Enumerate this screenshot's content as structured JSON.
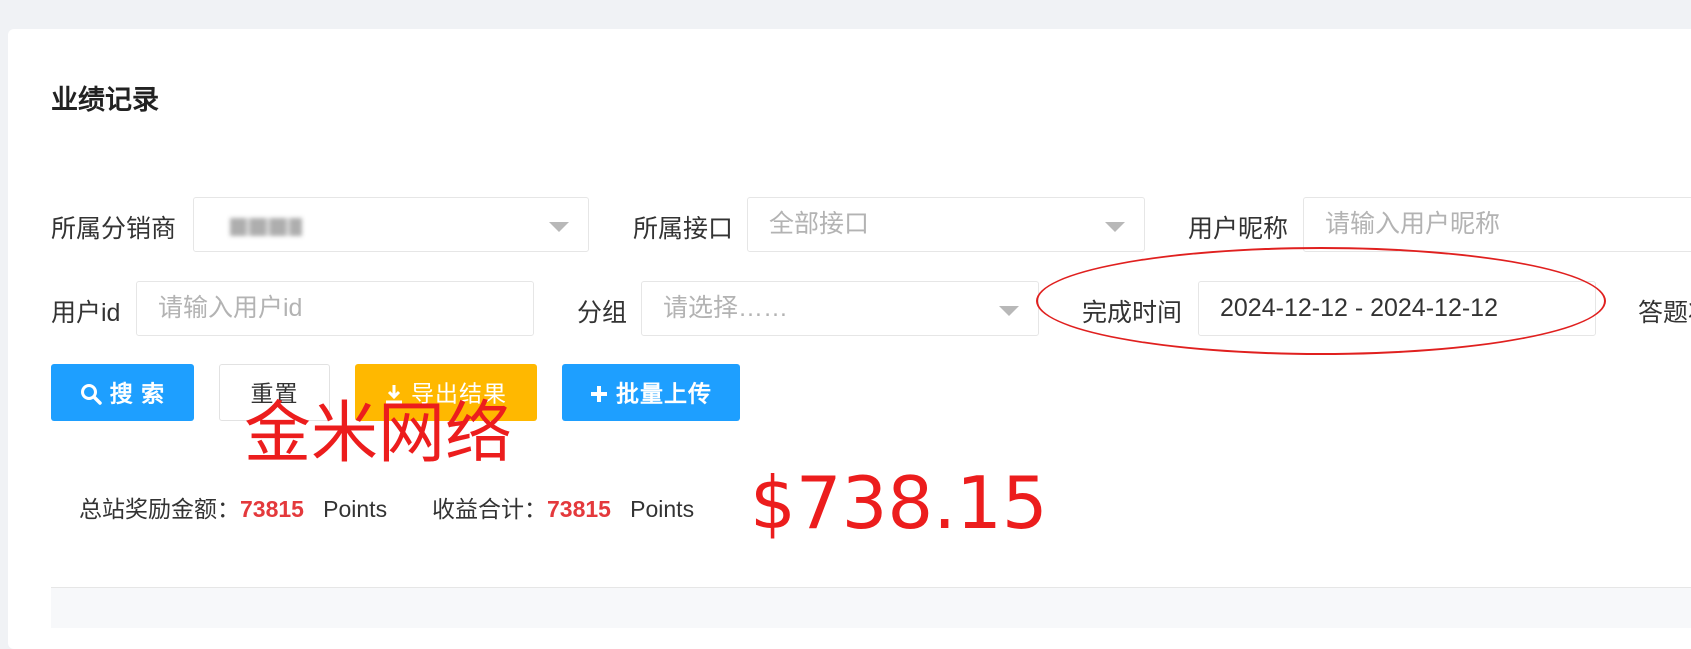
{
  "page": {
    "title": "业绩记录"
  },
  "filters": {
    "distributor": {
      "label": "所属分销商",
      "value": ""
    },
    "interface": {
      "label": "所属接口",
      "value": "全部接口"
    },
    "nickname": {
      "label": "用户昵称",
      "placeholder": "请输入用户昵称"
    },
    "user_id": {
      "label": "用户id",
      "placeholder": "请输入用户id"
    },
    "group": {
      "label": "分组",
      "placeholder": "请选择……"
    },
    "finish_time": {
      "label": "完成时间",
      "value": "2024-12-12 - 2024-12-12"
    },
    "truncated_label": "答题状"
  },
  "actions": {
    "search": "搜 索",
    "reset": "重置",
    "export": "导出结果",
    "batch_upload": "批量上传"
  },
  "summary": {
    "reward_label": "总站奖励金额：",
    "reward_value": "73815",
    "reward_unit": "Points",
    "income_label": "收益合计：",
    "income_value": "73815",
    "income_unit": "Points"
  },
  "overlays": {
    "watermark": "金米网络",
    "amount": "$738.15"
  },
  "colors": {
    "primary": "#1e9fff",
    "warning": "#ffb800",
    "value_red": "#e4393c",
    "annotation_red": "#ec1d1d"
  }
}
